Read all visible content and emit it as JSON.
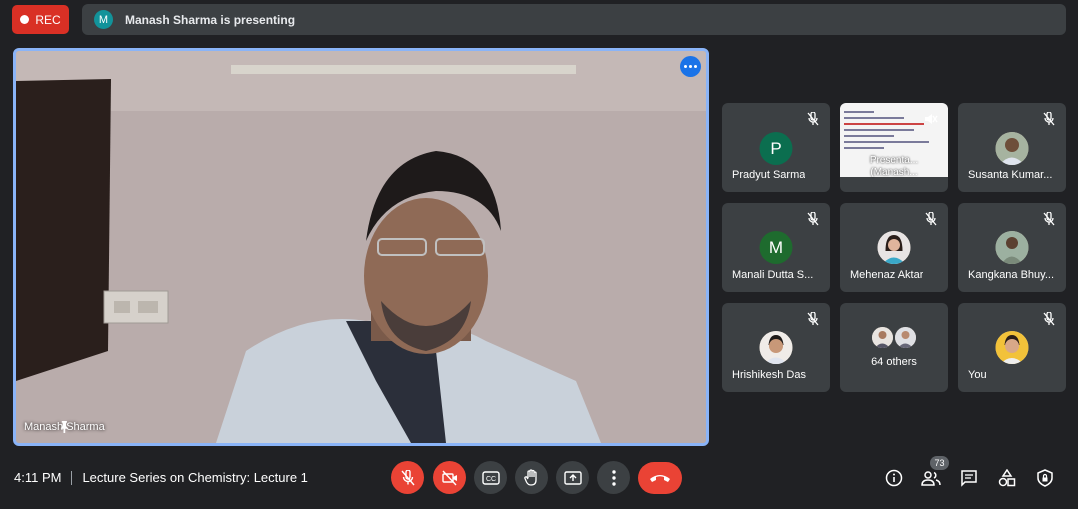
{
  "recording": {
    "label": "REC"
  },
  "presenting_bar": {
    "avatar_letter": "M",
    "text": "Manash Sharma is presenting"
  },
  "main_video": {
    "presenter_name": "Manash Sharma"
  },
  "tiles": [
    {
      "name": "Pradyut Sarma",
      "avatar_letter": "P",
      "avatar_color": "#0b6e4f"
    },
    {
      "screen_label_line1": "Presenta...",
      "screen_label_line2": "(Manash..."
    },
    {
      "name": "Susanta Kumar..."
    },
    {
      "name": "Manali Dutta S...",
      "avatar_letter": "M",
      "avatar_color": "#1e6b2e"
    },
    {
      "name": "Mehenaz Aktar"
    },
    {
      "name": "Kangkana Bhuy..."
    },
    {
      "name": "Hrishikesh Das"
    },
    {
      "others_label": "64 others"
    },
    {
      "name": "You"
    }
  ],
  "bottom_bar": {
    "time": "4:11 PM",
    "meeting_title": "Lecture Series on Chemistry: Lecture 1",
    "participants_count": "73",
    "cc_label": "CC"
  },
  "colors": {
    "accent": "#8ab4f8",
    "danger": "#ea4335",
    "surface": "#3c4043",
    "background": "#202124"
  }
}
